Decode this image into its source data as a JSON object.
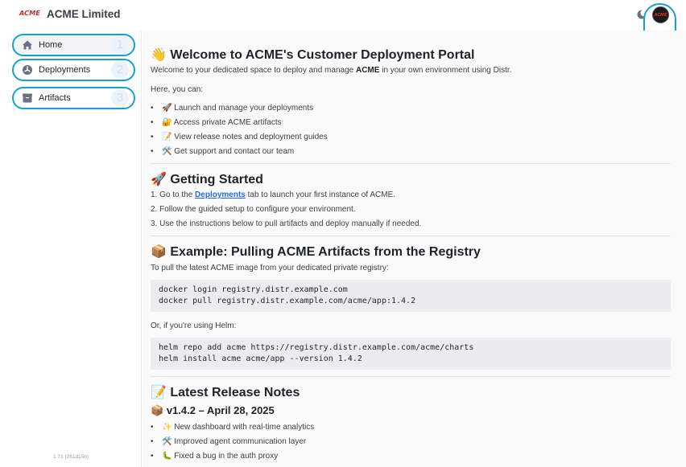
{
  "header": {
    "logo_text": "ACME",
    "title": "ACME Limited",
    "avatar_text": "ACME"
  },
  "sidebar": {
    "items": [
      {
        "label": "Home",
        "badge": "1",
        "icon": "home-icon"
      },
      {
        "label": "Deployments",
        "badge": "2",
        "icon": "dashboard-icon"
      },
      {
        "label": "Artifacts",
        "badge": "3",
        "icon": "box-icon"
      }
    ],
    "version": "1.71 (261d15b)"
  },
  "overlay": {
    "badge4": "4"
  },
  "main": {
    "welcome": {
      "emoji": "👋",
      "title": "Welcome to ACME's Customer Deployment Portal",
      "intro_pre": "Welcome to your dedicated space to deploy and manage ",
      "intro_bold": "ACME",
      "intro_post": " in your own environment using Distr.",
      "here": "Here, you can:",
      "bullets": [
        {
          "emoji": "🚀",
          "text": "Launch and manage your deployments"
        },
        {
          "emoji": "🔐",
          "text": "Access private ACME artifacts"
        },
        {
          "emoji": "📝",
          "text": "View release notes and deployment guides"
        },
        {
          "emoji": "🛠️",
          "text": "Get support and contact our team"
        }
      ]
    },
    "getting_started": {
      "emoji": "🚀",
      "title": "Getting Started",
      "step1_pre": "1. Go to the ",
      "step1_link": "Deployments",
      "step1_post": " tab to launch your first instance of ACME.",
      "step2": "2. Follow the guided setup to configure your environment.",
      "step3": "3. Use the instructions below to pull artifacts and deploy manually if needed."
    },
    "example": {
      "emoji": "📦",
      "title": "Example: Pulling ACME Artifacts from the Registry",
      "intro": "To pull the latest ACME image from your dedicated private registry:",
      "docker_code": "docker login registry.distr.example.com\ndocker pull registry.distr.example.com/acme/app:1.4.2",
      "helm_intro": "Or, if you're using Helm:",
      "helm_code": "helm repo add acme https://registry.distr.example.com/acme/charts\nhelm install acme acme/app --version 1.4.2"
    },
    "release_notes": {
      "emoji": "📝",
      "title": "Latest Release Notes",
      "version_emoji": "📦",
      "version_title": "v1.4.2 – April 28, 2025",
      "bullets": [
        {
          "emoji": "✨",
          "text": "New dashboard with real-time analytics"
        },
        {
          "emoji": "🛠️",
          "text": "Improved agent communication layer"
        },
        {
          "emoji": "🐛",
          "text": "Fixed a bug in the auth proxy"
        }
      ]
    }
  }
}
